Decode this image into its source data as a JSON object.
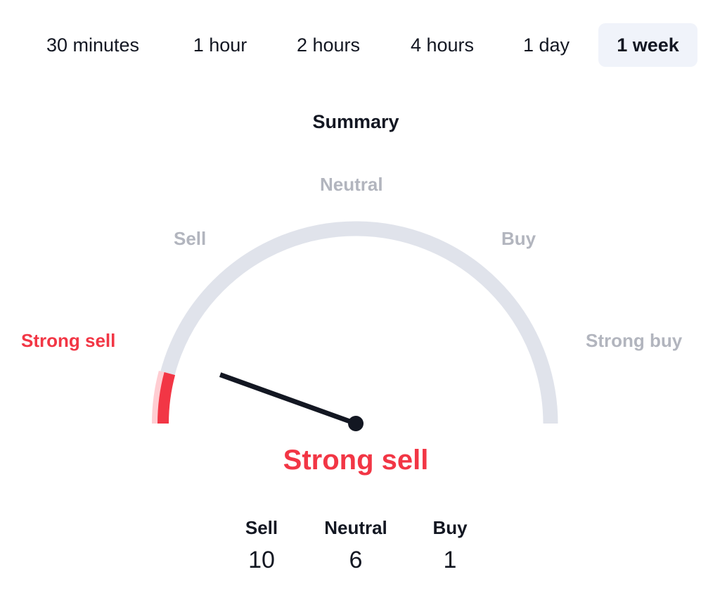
{
  "tabs": [
    {
      "label": "30 minutes",
      "active": false
    },
    {
      "label": "1 hour",
      "active": false
    },
    {
      "label": "2 hours",
      "active": false
    },
    {
      "label": "4 hours",
      "active": false
    },
    {
      "label": "1 day",
      "active": false
    },
    {
      "label": "1 week",
      "active": true
    }
  ],
  "summary": {
    "title": "Summary",
    "gauge": {
      "scale_labels": [
        "Strong sell",
        "Sell",
        "Neutral",
        "Buy",
        "Strong buy"
      ],
      "active_label": "Strong sell",
      "needle_fraction": 0.11,
      "filled_segment": "Strong sell",
      "colors": {
        "track": "#e0e3eb",
        "active": "#f23645",
        "active_light": "#ffcdd2",
        "needle": "#131722",
        "inactive_label": "#b2b5be"
      }
    },
    "verdict": "Strong sell",
    "counts": [
      {
        "label": "Sell",
        "value": "10"
      },
      {
        "label": "Neutral",
        "value": "6"
      },
      {
        "label": "Buy",
        "value": "1"
      }
    ]
  }
}
